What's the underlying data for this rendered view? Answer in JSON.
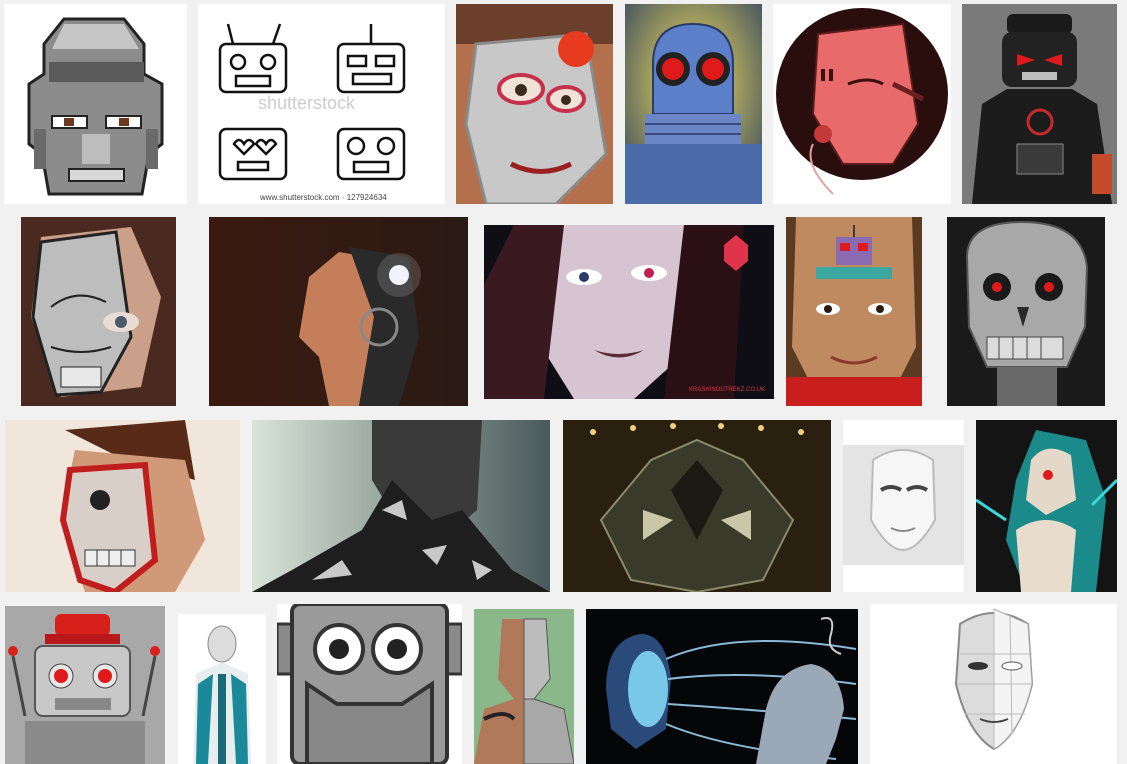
{
  "gallery": {
    "watermark_text": "shutterstock",
    "stock_caption": "www.shutterstock.com · 127924634",
    "logo_caption": "KRASHINOUTREKZ.CO.UK",
    "tiles": [
      {
        "desc": "pixel-art robot face"
      },
      {
        "desc": "four robot head doodles"
      },
      {
        "desc": "child with silver robot face paint"
      },
      {
        "desc": "blue robot head with red eyes"
      },
      {
        "desc": "pink robot mask on dark circle"
      },
      {
        "desc": "black toy figure with red eyes"
      },
      {
        "desc": "woman with half robot face paint"
      },
      {
        "desc": "android woman in profile with glowing ear"
      },
      {
        "desc": "cyborg woman with red eye"
      },
      {
        "desc": "boy with robot painted on forehead"
      },
      {
        "desc": "metal skull endoskeleton"
      },
      {
        "desc": "man with red robot face paint"
      },
      {
        "desc": "figure with metallic shards"
      },
      {
        "desc": "symmetric robot in corridor"
      },
      {
        "desc": "white face mask"
      },
      {
        "desc": "teal cyborg figure"
      },
      {
        "desc": "vintage toy robot with red hat"
      },
      {
        "desc": "white and teal android"
      },
      {
        "desc": "grey cartoon robot head"
      },
      {
        "desc": "man with half robot body paint"
      },
      {
        "desc": "blue android heads with wires"
      },
      {
        "desc": "wireframe 3d human face"
      }
    ]
  },
  "colors": {
    "page_bg": "#f1f1f1",
    "accent_red": "#e0141c",
    "metal_grey": "#9a9a9a"
  }
}
